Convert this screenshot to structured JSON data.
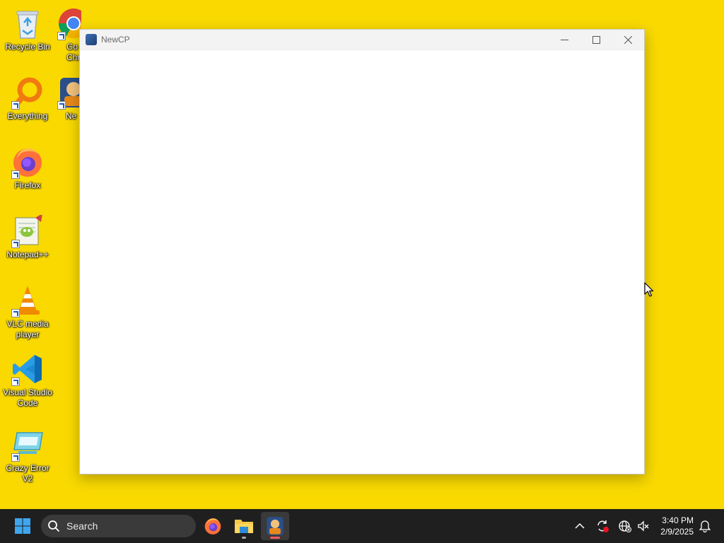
{
  "desktop": {
    "background_color": "#f9d900",
    "icons": [
      {
        "label": "Recycle Bin",
        "icon": "recycle-bin-icon"
      },
      {
        "label": "Go Chr",
        "icon": "google-chrome-icon"
      },
      {
        "label": "Everything",
        "icon": "everything-search-icon"
      },
      {
        "label": "Ne",
        "icon": "newcp-icon"
      },
      {
        "label": "Firefox",
        "icon": "firefox-icon"
      },
      {
        "label": "Notepad++",
        "icon": "notepad-plus-plus-icon"
      },
      {
        "label": "VLC media player",
        "icon": "vlc-icon"
      },
      {
        "label": "Visual Studio Code",
        "icon": "vscode-icon"
      },
      {
        "label": "Crazy Error V2",
        "icon": "crazy-error-icon"
      }
    ]
  },
  "window": {
    "title": "NewCP",
    "controls": {
      "minimize": "minimize-icon",
      "maximize": "maximize-icon",
      "close": "close-icon"
    }
  },
  "taskbar": {
    "search_label": "Search",
    "apps": [
      {
        "name": "firefox",
        "icon": "firefox-icon"
      },
      {
        "name": "file-explorer",
        "icon": "folder-icon"
      },
      {
        "name": "newcp",
        "icon": "newcp-icon",
        "active": true
      }
    ],
    "tray": {
      "time": "3:40 PM",
      "date": "2/9/2025"
    },
    "accent_color": "#0078d4"
  }
}
